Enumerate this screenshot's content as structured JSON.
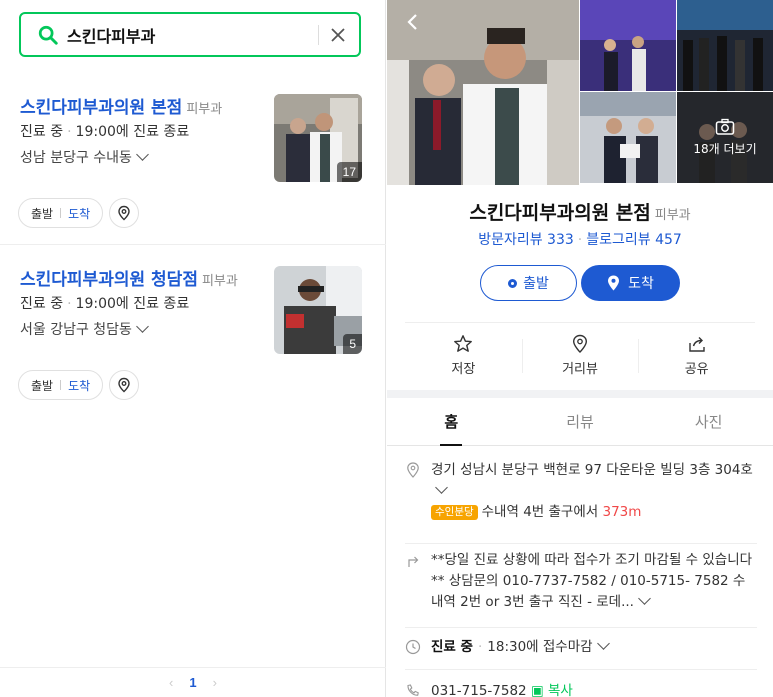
{
  "search": {
    "query": "스킨다피부과"
  },
  "results": [
    {
      "name": "스킨다피부과의원 본점",
      "category": "피부과",
      "status": "진료 중",
      "hours": "19:00에 진료 종료",
      "address": "성남 분당구 수내동",
      "photo_count": "17",
      "start_label": "출발",
      "arrive_label": "도착"
    },
    {
      "name": "스킨다피부과의원 청담점",
      "category": "피부과",
      "status": "진료 중",
      "hours": "19:00에 진료 종료",
      "address": "서울 강남구 청담동",
      "photo_count": "5",
      "start_label": "출발",
      "arrive_label": "도착"
    }
  ],
  "pager": {
    "current": "1"
  },
  "detail": {
    "more_photos": "18개 더보기",
    "name": "스킨다피부과의원 본점",
    "category": "피부과",
    "visitor_reviews": "방문자리뷰 333",
    "blog_reviews": "블로그리뷰 457",
    "start_label": "출발",
    "arrive_label": "도착",
    "actions": {
      "save": "저장",
      "distance": "거리뷰",
      "share": "공유"
    },
    "tabs": {
      "home": "홈",
      "review": "리뷰",
      "photo": "사진"
    },
    "address": "경기 성남시 분당구 백현로 97 다운타운 빌딩 3층 304호",
    "station_badge": "수인분당",
    "station_text": "수내역 4번 출구에서",
    "station_distance": "373m",
    "notice": "**당일 진료 상황에 따라 접수가 조기 마감될 수 있습니다** 상담문의 010-7737-7582 / 010-5715- 7582 수내역 2번 or 3번 출구 직진 - 로데...",
    "hours_status": "진료 중",
    "hours_text": "18:30에 접수마감",
    "phone": "031-715-7582",
    "copy_label": "복사"
  },
  "colors": {
    "accent": "#1e5ad2",
    "search_border": "#03c75a",
    "station": "#f7a400",
    "distance": "#f04848"
  }
}
